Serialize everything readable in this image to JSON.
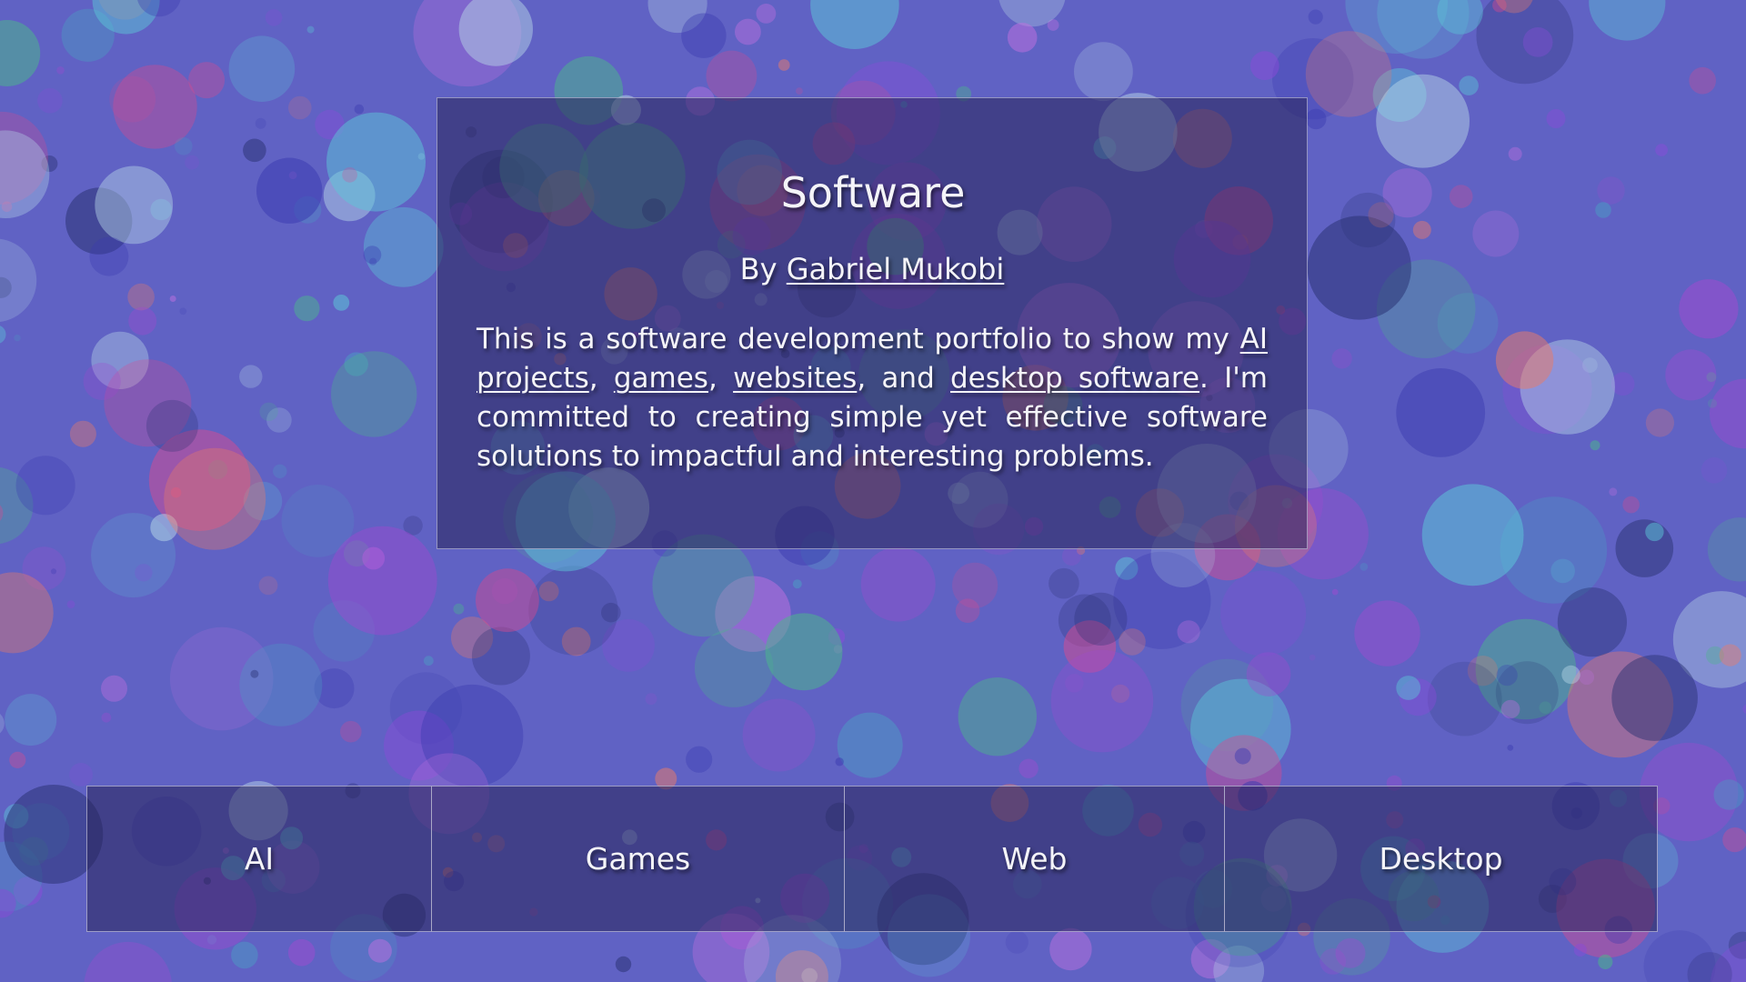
{
  "theme": {
    "background": "#6062c4",
    "panel": "rgba(40, 36, 90, 0.55)",
    "text": "#f4f4f8",
    "bubble_colors": [
      "#d84a8f",
      "#4a9fc4",
      "#8a4ad8",
      "#3a3ab0",
      "#b8d8e8",
      "#4ab88a",
      "#e87a6a",
      "#a04ad0",
      "#283070",
      "#c070e0",
      "#5cc8d8"
    ]
  },
  "hero": {
    "title": "Software",
    "byline_prefix": "By ",
    "author": "Gabriel Mukobi",
    "desc_1": "This is a software development portfolio to show my ",
    "link_ai": "AI projects",
    "sep_1": ", ",
    "link_games": "games",
    "sep_2": ", ",
    "link_websites": "websites",
    "sep_3": ", and ",
    "link_desktop": "desktop software",
    "desc_2": ". I'm committed to creating simple yet effective software solutions to impactful and interesting problems."
  },
  "nav": {
    "ai": "AI",
    "games": "Games",
    "web": "Web",
    "desktop": "Desktop"
  }
}
